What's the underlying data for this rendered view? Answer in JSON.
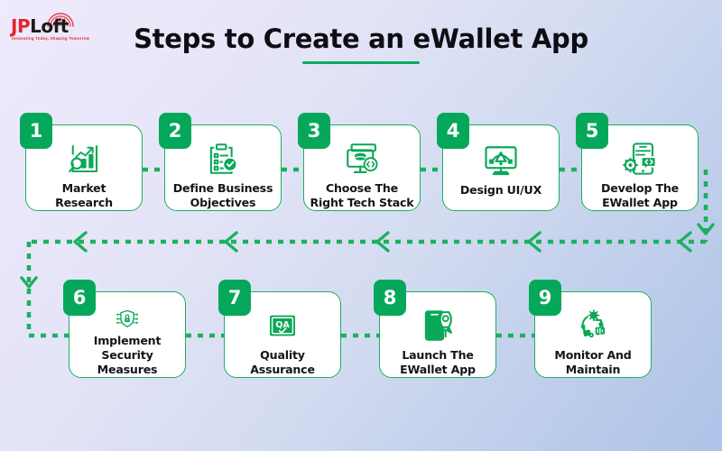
{
  "brand": {
    "name_part1": "JP",
    "name_part2": "Loft",
    "tagline": "Innovating Today, Shaping Tomorrow",
    "logo_icon": "fingerprint-arc-icon",
    "color_red": "#e8232a",
    "color_dark": "#1b1b1b"
  },
  "header": {
    "title": "Steps to Create an eWallet App",
    "underline_color": "#0bab5b"
  },
  "theme": {
    "accent_green": "#05a85a",
    "card_border_green": "#19b05e",
    "card_background": "#ffffff",
    "background_from": "#efeafc",
    "background_to": "#adc3e8",
    "text_dark": "#14141c"
  },
  "flow": {
    "direction_row1": "left-to-right",
    "direction_row2": "right-to-left",
    "connector_style": "dotted",
    "connector_color": "#1cb05f",
    "arrow_icon": "chevron-arrow-icon"
  },
  "steps": [
    {
      "number": "1",
      "label": "Market Research",
      "icon": "bar-chart-magnifier-icon",
      "row": 1
    },
    {
      "number": "2",
      "label": "Define Business Objectives",
      "icon": "clipboard-check-icon",
      "row": 1
    },
    {
      "number": "3",
      "label": "Choose The Right Tech Stack",
      "icon": "monitor-database-code-icon",
      "row": 1
    },
    {
      "number": "4",
      "label": "Design UI/UX",
      "icon": "monitor-pen-tool-icon",
      "row": 1
    },
    {
      "number": "5",
      "label": "Develop The EWallet App",
      "icon": "phone-gear-code-icon",
      "row": 1
    },
    {
      "number": "6",
      "label": "Implement Security Measures",
      "icon": "shield-lock-circuit-icon",
      "row": 2
    },
    {
      "number": "7",
      "label": "Quality Assurance",
      "icon": "qa-check-box-icon",
      "row": 2
    },
    {
      "number": "8",
      "label": "Launch The EWallet App",
      "icon": "phone-rocket-launch-icon",
      "row": 2
    },
    {
      "number": "9",
      "label": "Monitor And Maintain",
      "icon": "refresh-gear-monitor-icon",
      "row": 2
    }
  ]
}
